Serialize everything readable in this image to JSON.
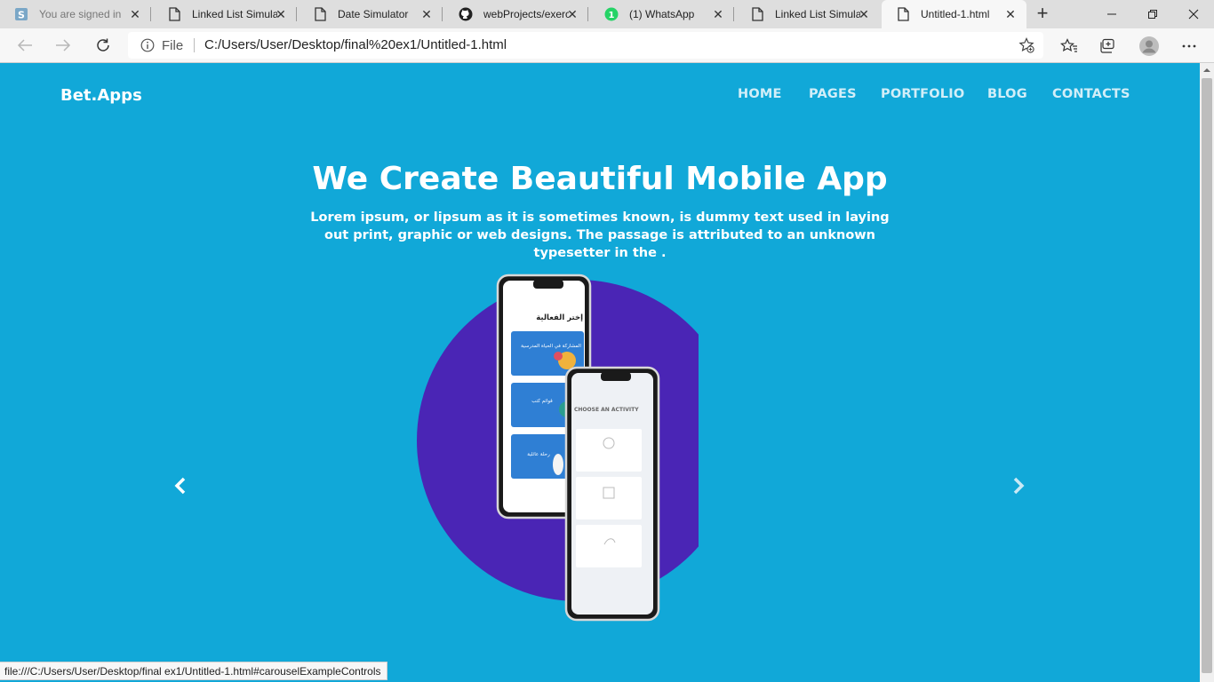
{
  "browser": {
    "tabs": [
      {
        "label": "You are signed in as",
        "icon": "s-logo-icon",
        "active": false,
        "faded": true
      },
      {
        "label": "Linked List Simulator",
        "icon": "page-icon",
        "active": false,
        "faded": false
      },
      {
        "label": "Date Simulator",
        "icon": "page-icon",
        "active": false,
        "faded": false
      },
      {
        "label": "webProjects/exercise",
        "icon": "github-icon",
        "active": false,
        "faded": false
      },
      {
        "label": "(1) WhatsApp",
        "icon": "whatsapp-icon",
        "active": false,
        "faded": false
      },
      {
        "label": "Linked List Simulator",
        "icon": "page-icon",
        "active": false,
        "faded": false
      },
      {
        "label": "Untitled-1.html",
        "icon": "page-icon",
        "active": true,
        "faded": false
      }
    ],
    "address": {
      "scheme_label": "File",
      "url": "C:/Users/User/Desktop/final%20ex1/Untitled-1.html"
    },
    "status_text": "file:///C:/Users/User/Desktop/final ex1/Untitled-1.html#carouselExampleControls"
  },
  "page": {
    "brand": "Bet.Apps",
    "nav": [
      "HOME",
      "PAGES",
      "PORTFOLIO",
      "BLOG",
      "CONTACTS"
    ],
    "hero": {
      "title": "We Create Beautiful Mobile App",
      "text": "Lorem ipsum, or lipsum as it is sometimes known, is dummy text used in laying out print, graphic or web designs. The passage is attributed to an unknown typesetter in the ."
    },
    "mockup": {
      "phone1_heading": "إختر الفعالية",
      "phone1_cards": [
        "المشاركة في الحياة المدرسية",
        "قوائم كتب",
        "رحلة عائلية"
      ],
      "phone2_heading": "CHOOSE AN ACTIVITY"
    }
  },
  "colors": {
    "page_bg": "#11a8d8",
    "circle": "#4a25b5",
    "nav_text": "#d2eef8"
  }
}
